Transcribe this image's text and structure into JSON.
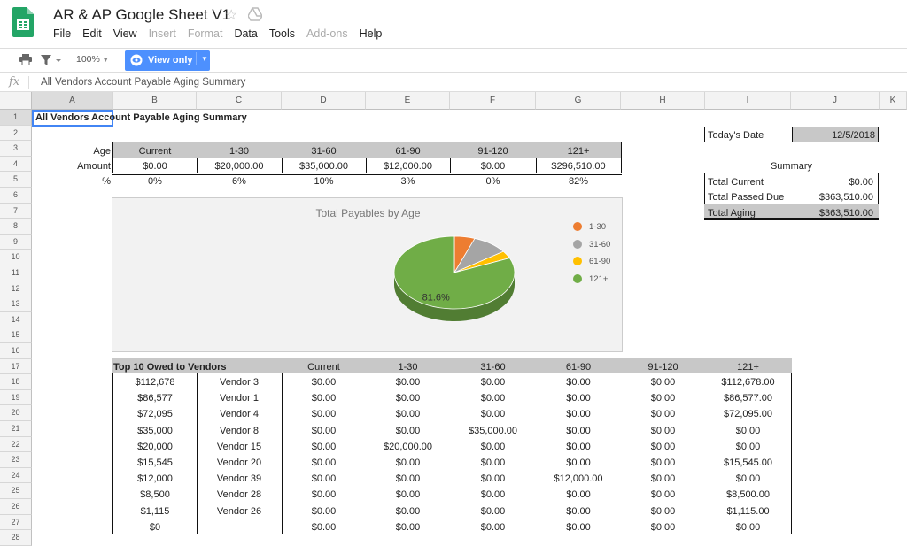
{
  "app": {
    "title": "AR & AP Google Sheet V1",
    "menu": [
      {
        "label": "File",
        "enabled": true
      },
      {
        "label": "Edit",
        "enabled": true
      },
      {
        "label": "View",
        "enabled": true
      },
      {
        "label": "Insert",
        "enabled": false
      },
      {
        "label": "Format",
        "enabled": false
      },
      {
        "label": "Data",
        "enabled": true
      },
      {
        "label": "Tools",
        "enabled": true
      },
      {
        "label": "Add-ons",
        "enabled": false
      },
      {
        "label": "Help",
        "enabled": true
      }
    ]
  },
  "toolbar": {
    "zoom": "100%",
    "view_only_label": "View only"
  },
  "formula_bar": {
    "fx": "fx",
    "value": "All Vendors Account Payable Aging Summary"
  },
  "columns": [
    "A",
    "B",
    "C",
    "D",
    "E",
    "F",
    "G",
    "H",
    "I",
    "J",
    "K"
  ],
  "rows": [
    "1",
    "2",
    "3",
    "4",
    "5",
    "6",
    "7",
    "8",
    "9",
    "10",
    "11",
    "12",
    "13",
    "14",
    "15",
    "16",
    "17",
    "18",
    "19",
    "20",
    "21",
    "22",
    "23",
    "24",
    "25",
    "26",
    "27",
    "28"
  ],
  "sheet": {
    "title_cell": "All Vendors Account Payable Aging Summary",
    "age_label": "Age",
    "amount_label": "Amount",
    "pct_label": "%",
    "age_headers": [
      "Current",
      "1-30",
      "31-60",
      "61-90",
      "91-120",
      "121+"
    ],
    "amounts": [
      "$0.00",
      "$20,000.00",
      "$35,000.00",
      "$12,000.00",
      "$0.00",
      "$296,510.00"
    ],
    "percents": [
      "0%",
      "6%",
      "10%",
      "3%",
      "0%",
      "82%"
    ],
    "today_label": "Today's Date",
    "today_value": "12/5/2018",
    "summary_title": "Summary",
    "summary": [
      {
        "label": "Total Current",
        "value": "$0.00"
      },
      {
        "label": "Total Passed Due",
        "value": "$363,510.00"
      },
      {
        "label": "Total Aging",
        "value": "$363,510.00"
      }
    ],
    "top10": {
      "headers": [
        "Top 10 Owed to Vendors",
        "",
        "Current",
        "1-30",
        "31-60",
        "61-90",
        "91-120",
        "121+"
      ],
      "rows": [
        [
          "$112,678",
          "Vendor 3",
          "$0.00",
          "$0.00",
          "$0.00",
          "$0.00",
          "$0.00",
          "$112,678.00"
        ],
        [
          "$86,577",
          "Vendor 1",
          "$0.00",
          "$0.00",
          "$0.00",
          "$0.00",
          "$0.00",
          "$86,577.00"
        ],
        [
          "$72,095",
          "Vendor 4",
          "$0.00",
          "$0.00",
          "$0.00",
          "$0.00",
          "$0.00",
          "$72,095.00"
        ],
        [
          "$35,000",
          "Vendor 8",
          "$0.00",
          "$0.00",
          "$35,000.00",
          "$0.00",
          "$0.00",
          "$0.00"
        ],
        [
          "$20,000",
          "Vendor 15",
          "$0.00",
          "$20,000.00",
          "$0.00",
          "$0.00",
          "$0.00",
          "$0.00"
        ],
        [
          "$15,545",
          "Vendor 20",
          "$0.00",
          "$0.00",
          "$0.00",
          "$0.00",
          "$0.00",
          "$15,545.00"
        ],
        [
          "$12,000",
          "Vendor 39",
          "$0.00",
          "$0.00",
          "$0.00",
          "$12,000.00",
          "$0.00",
          "$0.00"
        ],
        [
          "$8,500",
          "Vendor 28",
          "$0.00",
          "$0.00",
          "$0.00",
          "$0.00",
          "$0.00",
          "$8,500.00"
        ],
        [
          "$1,115",
          "Vendor 26",
          "$0.00",
          "$0.00",
          "$0.00",
          "$0.00",
          "$0.00",
          "$1,115.00"
        ],
        [
          "$0",
          "",
          "$0.00",
          "$0.00",
          "$0.00",
          "$0.00",
          "$0.00",
          "$0.00"
        ]
      ]
    }
  },
  "chart_data": {
    "type": "pie",
    "title": "Total Payables by Age",
    "categories": [
      "1-30",
      "31-60",
      "61-90",
      "121+"
    ],
    "values": [
      20000,
      35000,
      12000,
      296510
    ],
    "colors": [
      "#ed7d31",
      "#a5a5a5",
      "#ffc000",
      "#70ad47"
    ],
    "data_labels": [
      "",
      "",
      "",
      "81.6%"
    ],
    "legend": "right"
  }
}
